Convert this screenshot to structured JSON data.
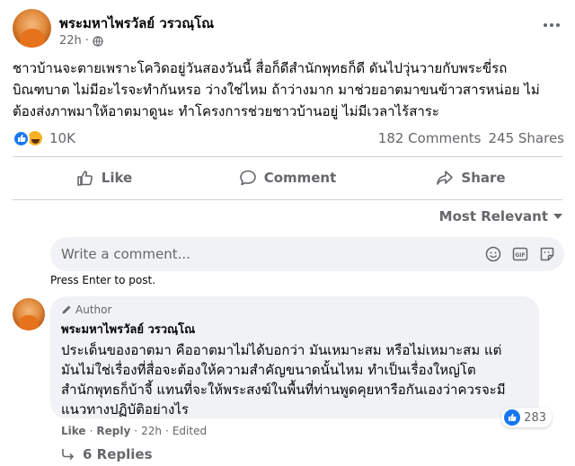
{
  "post": {
    "author": "พระมหาไพรวัลย์ วรวณฺโณ",
    "time": "22h",
    "privacy_icon": "globe-icon",
    "text": "ชาวบ้านจะตายเพราะโควิดอยู่วันสองวันนี้ สื่อก็ดีสำนักพุทธก็ดี ดันไปวุ่นวายกับพระขี่รถ\nบิณฑบาต ไม่มีอะไรจะทำกันหรอ ว่างใช่ไหม ถ้าว่างมาก มาช่วยอาตมาขนข้าวสารหน่อย ไม่\nต้องส่งภาพมาให้อาตมาดูนะ ทำโครงการช่วยชาวบ้านอยู่ ไม่มีเวลาไร้สาระ",
    "reactions_count": "10K",
    "comments_count": "182 Comments",
    "shares_count": "245 Shares"
  },
  "actions": {
    "like_label": "Like",
    "comment_label": "Comment",
    "share_label": "Share"
  },
  "sort": {
    "label": "Most Relevant"
  },
  "comment_input": {
    "placeholder": "Write a comment...",
    "hint": "Press Enter to post."
  },
  "comment": {
    "badge": "Author",
    "author": "พระมหาไพรวัลย์ วรวณฺโณ",
    "text": "ประเด็นของอาตมา คืออาตมาไม่ได้บอกว่า มันเหมาะสม หรือไม่เหมาะสม แต่\nมันไม่ใช่เรื่องที่สื่อจะต้องให้ความสำคัญขนาดนั้นไหม ทำเป็นเรื่องใหญ่โต\nสำนักพุทธก็บ้าจี้ แทนที่จะให้พระสงฆ์ในพื้นที่ท่านพูดคุยหารือกันเองว่าควรจะมี\nแนวทางปฏิบัติอย่างไร",
    "reactions_count": "283",
    "like_link": "Like",
    "separator": "·",
    "reply_link": "Reply",
    "time": "22h",
    "edited": "Edited",
    "replies_label": "6 Replies"
  },
  "colors": {
    "accent": "#1877f2",
    "secondary_text": "#65676b",
    "bubble_bg": "#f0f2f5"
  }
}
